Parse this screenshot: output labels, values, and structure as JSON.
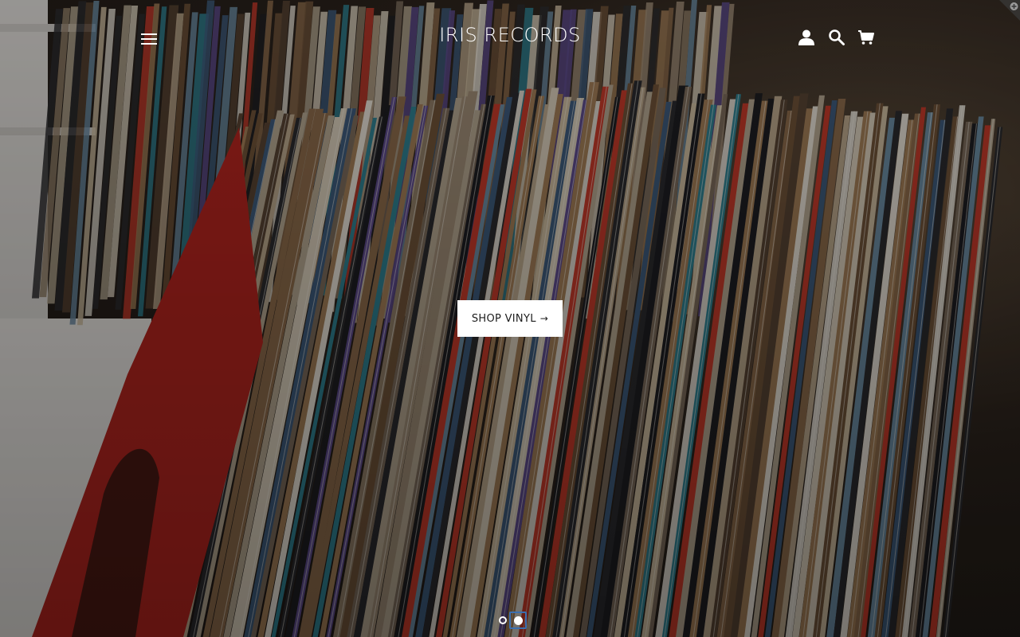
{
  "store": {
    "name": "IRIS RECORDS"
  },
  "header": {
    "menu_icon": "hamburger-menu-icon",
    "icons": [
      "account-icon",
      "search-icon",
      "cart-icon"
    ]
  },
  "hero": {
    "cta_label": "SHOP VINYL",
    "cta_arrow": "→",
    "slides_count": 2,
    "active_slide": 2
  },
  "colors": {
    "header_text": "#ffffff",
    "cta_background": "#ffffff",
    "cta_text": "#1c1c1c",
    "focus_outline": "#3b6fb0"
  }
}
